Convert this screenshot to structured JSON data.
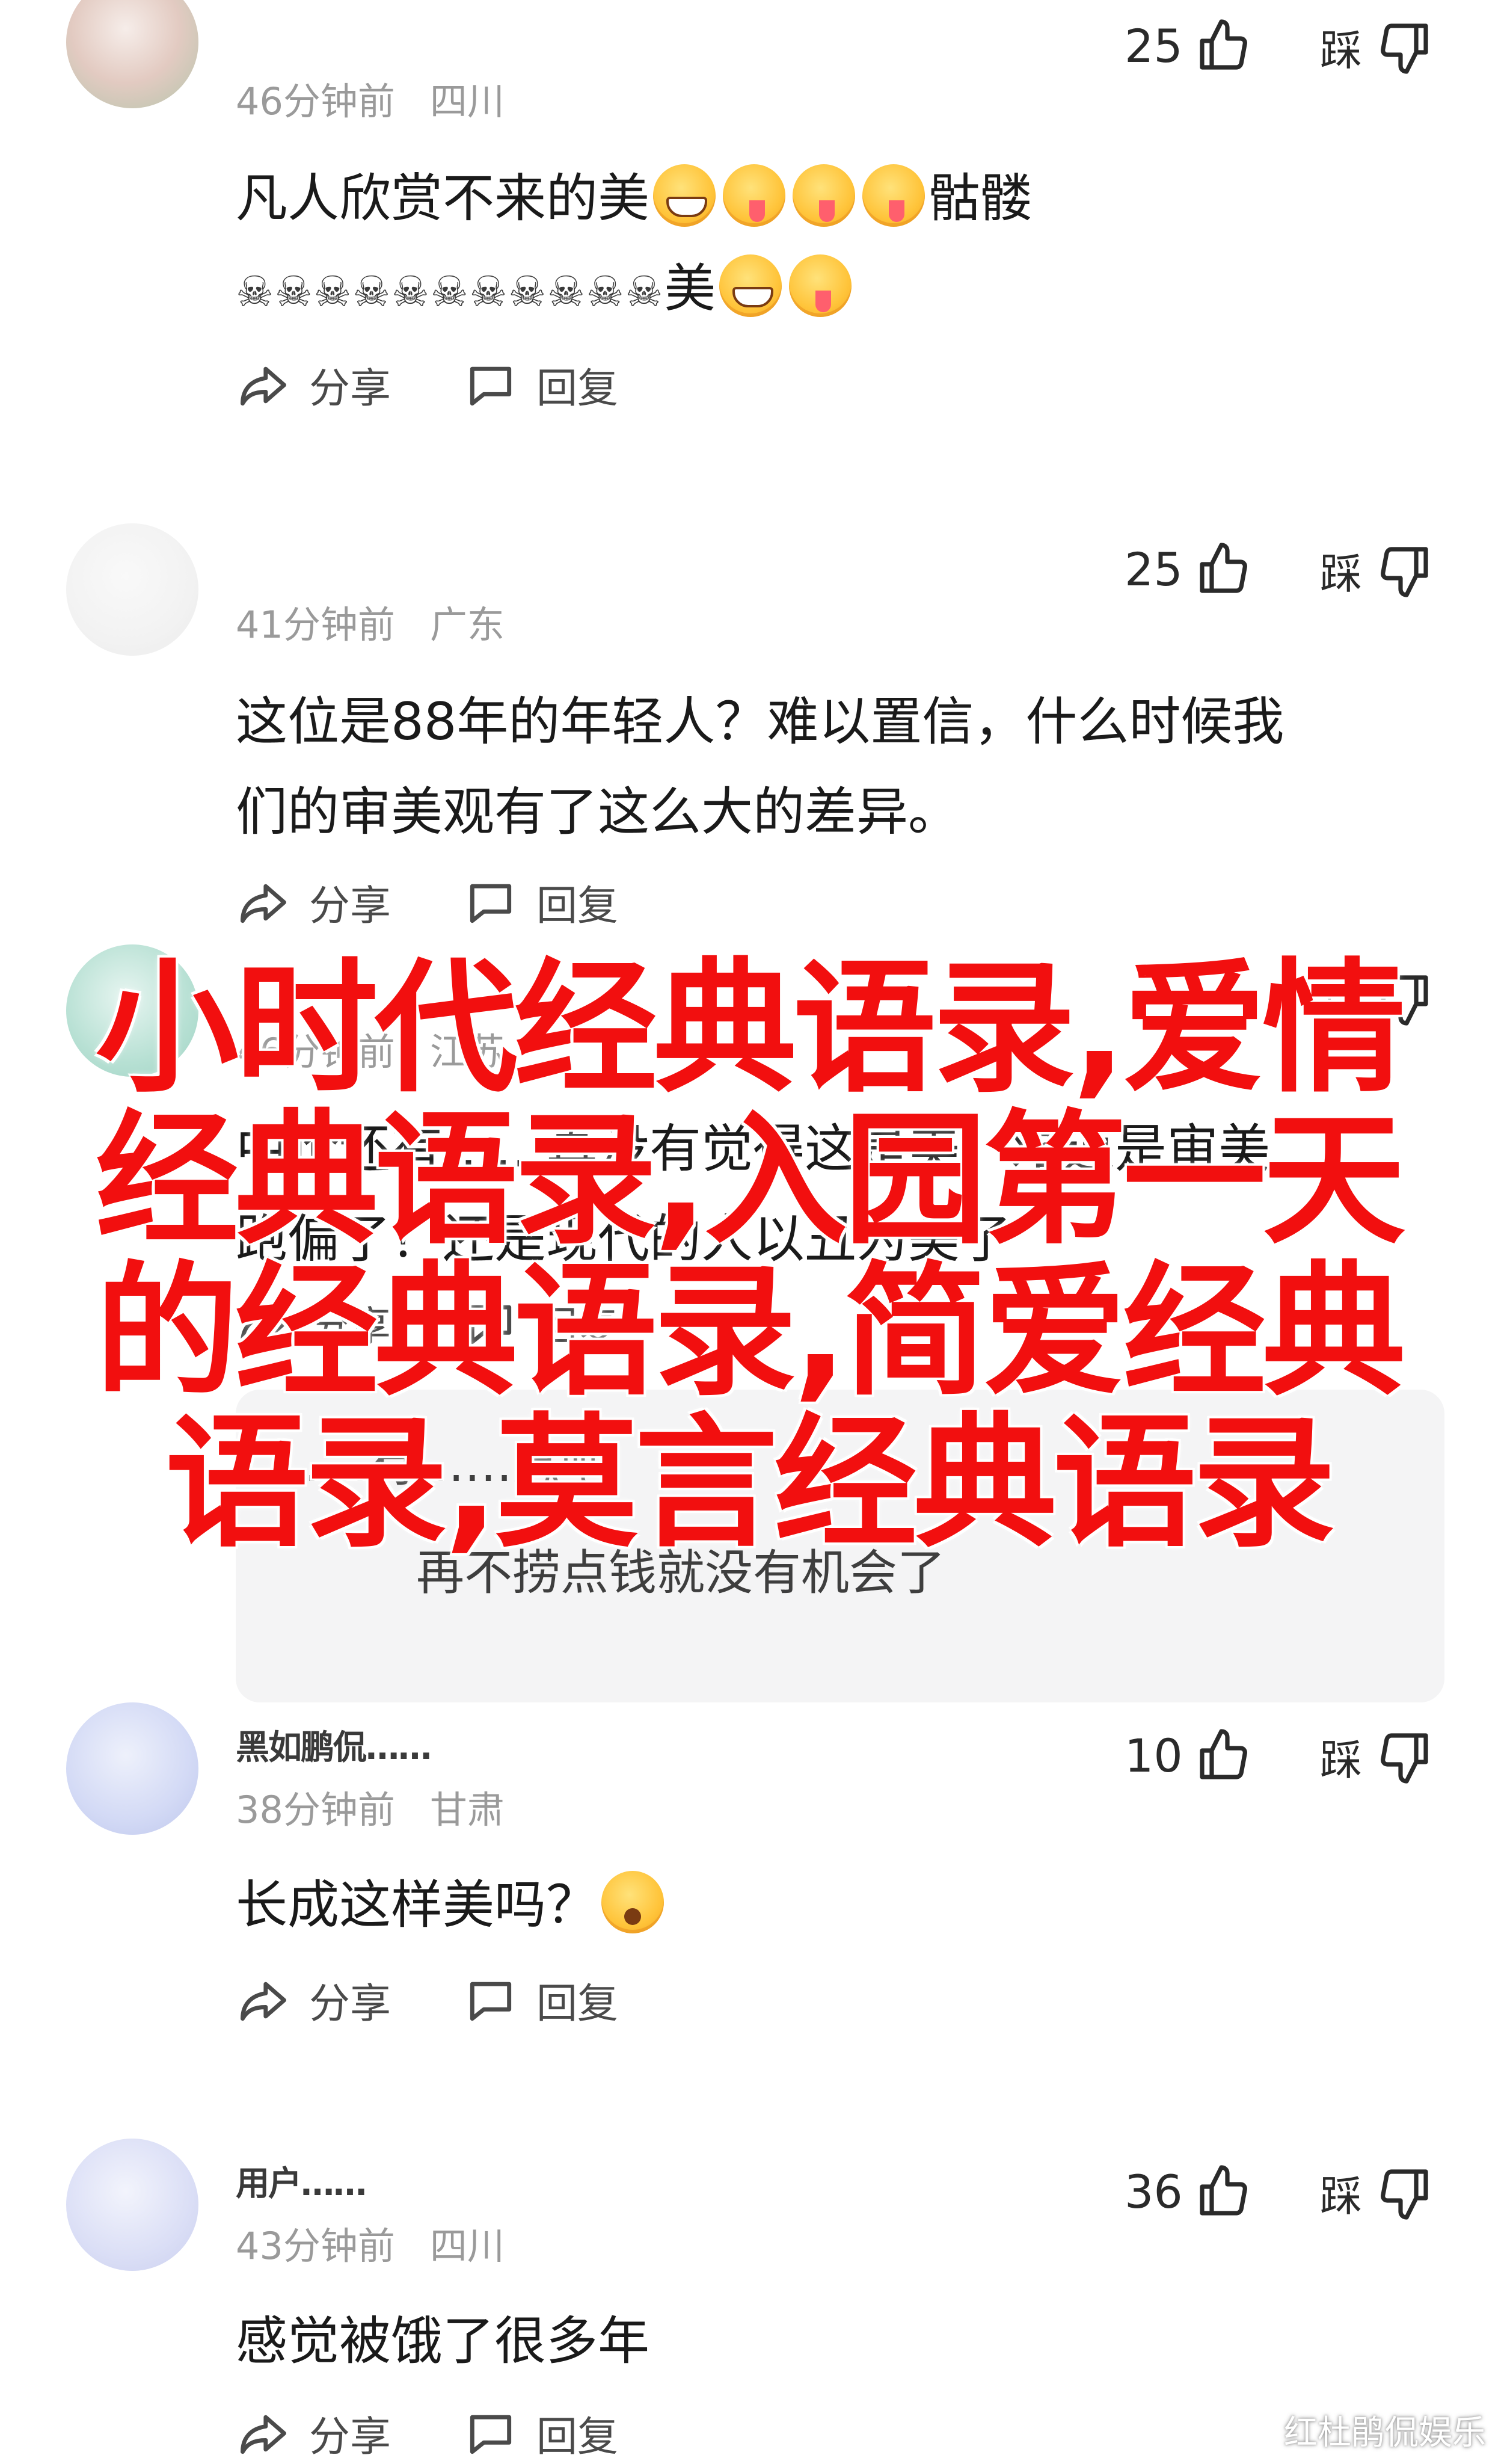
{
  "comments": [
    {
      "likes": "25",
      "dislike_label": "踩",
      "time": "46分钟前",
      "location": "四川",
      "text_line1": "凡人欣赏不来的美",
      "text_line1_suffix": "骷髅",
      "text_line2_skulls": "☠☠☠☠☠☠☠☠☠☠☠",
      "text_line2_suffix": "美",
      "share_label": "分享",
      "reply_label": "回复"
    },
    {
      "likes": "25",
      "dislike_label": "踩",
      "time": "41分钟前",
      "location": "广东",
      "text_line1": "这位是88年的年轻人？难以置信，什么时候我",
      "text_line2": "们的审美观有了这么大的差异。",
      "share_label": "分享",
      "reply_label": "回复"
    },
    {
      "dislike_label": "踩",
      "time": "46分钟前",
      "location": "江苏",
      "text_line1": "中论还有……真没有觉得这是美，难道是审美",
      "text_line2": "跑偏了？还是现代的人以丑为美了",
      "share_label": "分享",
      "reply_label": "回复",
      "reply_line1": "……有……息吧",
      "reply_line2": "再不捞点钱就没有机会了"
    },
    {
      "username": "黑如鹏侃……",
      "likes": "10",
      "dislike_label": "踩",
      "time": "38分钟前",
      "location": "甘肃",
      "text_line1": "长成这样美吗？",
      "share_label": "分享",
      "reply_label": "回复"
    },
    {
      "username": "用户……",
      "likes": "36",
      "dislike_label": "踩",
      "time": "43分钟前",
      "location": "四川",
      "text_line1": "感觉被饿了很多年",
      "share_label": "分享",
      "reply_label": "回复"
    }
  ],
  "overlay": {
    "line1": "小时代经典语录,爱情",
    "line2": "经典语录,入园第一天",
    "line3": "的经典语录,简爱经典",
    "line4": "语录,莫言经典语录"
  },
  "watermark": "红杜鹃侃娱乐",
  "icons": {
    "like": "thumbs-up-icon",
    "dislike": "thumbs-down-icon",
    "share": "share-icon",
    "reply": "comment-icon"
  },
  "colors": {
    "overlay_red": "#f20f0f",
    "meta_gray": "#9a9a9a",
    "reply_bg": "#f4f4f5"
  }
}
